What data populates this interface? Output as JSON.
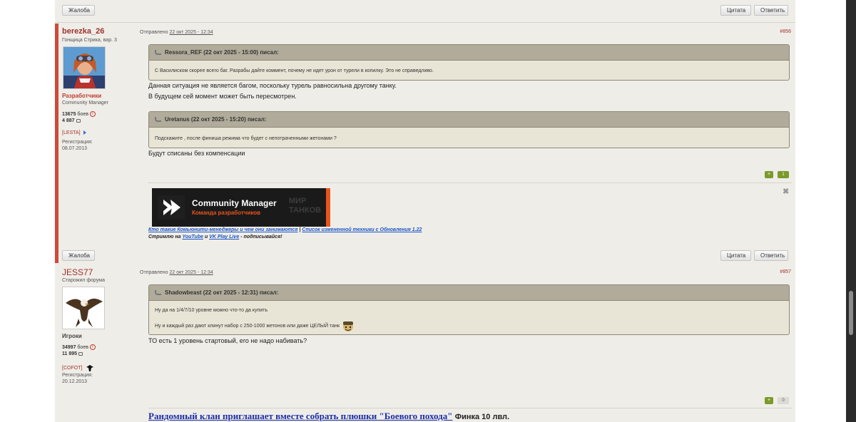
{
  "buttons": {
    "complaint": "Жалоба",
    "quote": "Цитата",
    "reply": "Ответить"
  },
  "posts": [
    {
      "author": "berezka_26",
      "rank": "Гонщица Стрика, вар. 3",
      "group": "Разработчики",
      "role": "Community Manager",
      "battles": "13675",
      "battles_suffix": "боев",
      "messages": "4 887",
      "clan": "[LESTA]",
      "reg_label": "Регистрация:",
      "reg_date": "08.07.2013",
      "sent_label": "Отправлено",
      "sent_date": "22 окт 2025 - 12:34",
      "number": "#856",
      "quote1_head": "Ressora_REF (22 окт 2025 - 15:00) писал:",
      "quote1_body": "С Василиском скорее всего баг. Разрабы дайте коммент, почему не идет урон от турели в копилку. Это не справедливо.",
      "reply1_line1": "Данная ситуация не является багом, поскольку турель равносильна другому танку.",
      "reply1_line2": "В будущем сей момент может быть пересмотрен.",
      "quote2_head": "Uretanus (22 окт 2025 - 15:20) писал:",
      "quote2_body": "Подскажите , после финиша режима  что будет с непотраченными жетонами ?",
      "reply2": "Будут списаны без компенсации",
      "rep_plus": "+",
      "rep_count": "1",
      "rep_color": "#7a9a2a",
      "banner_title": "Community Manager",
      "banner_sub": "Команда разработчиков",
      "banner_mir": "МИР ТАНКОВ",
      "sig_link1": "Кто такие Комьюнити-менеджеры и чем они занимаются",
      "sig_sep": "|",
      "sig_link2": "Список измененной техники с Обновления 1.22",
      "sig_stream": "Стримлю на",
      "sig_youtube": "YouTube",
      "sig_and": "и",
      "sig_vk": "VK Play Live",
      "sig_tail": "- подписывайся!"
    },
    {
      "author": "JESS77",
      "rank": "Старожил форума",
      "group": "Игроки",
      "battles": "34997",
      "battles_suffix": "боев",
      "messages": "11 895",
      "clan": "[COFOT]",
      "reg_label": "Регистрация:",
      "reg_date": "20.12.2013",
      "sent_label": "Отправлено",
      "sent_date": "22 окт 2025 - 12:34",
      "number": "#857",
      "quote_head": "Shadowbeast (22 окт 2025 - 12:31) писал:",
      "quote_line1": "Ну да на 1/4/7/10 уровне можно что-то да купить",
      "quote_line2": "Ну и каждый раз дают клинут набор с 250-1000 жетонов или даже ЦЕЛЫЙ танк",
      "reply": "ТО есть 1 уровень стартовый, его не надо набивать?",
      "rep_plus": "+",
      "rep_count": "0",
      "clan_ad_link": "Рандомный клан приглашает вместе собрать плюшки \"Боевого похода\"",
      "clan_ad_tail": "Финка 10 лвл."
    }
  ],
  "close_glyph": "✖",
  "colors": {
    "accent": "#a0322b",
    "dev_bar": "#d04a3a",
    "banner_orange": "#e8541e",
    "link": "#1a55c4"
  }
}
